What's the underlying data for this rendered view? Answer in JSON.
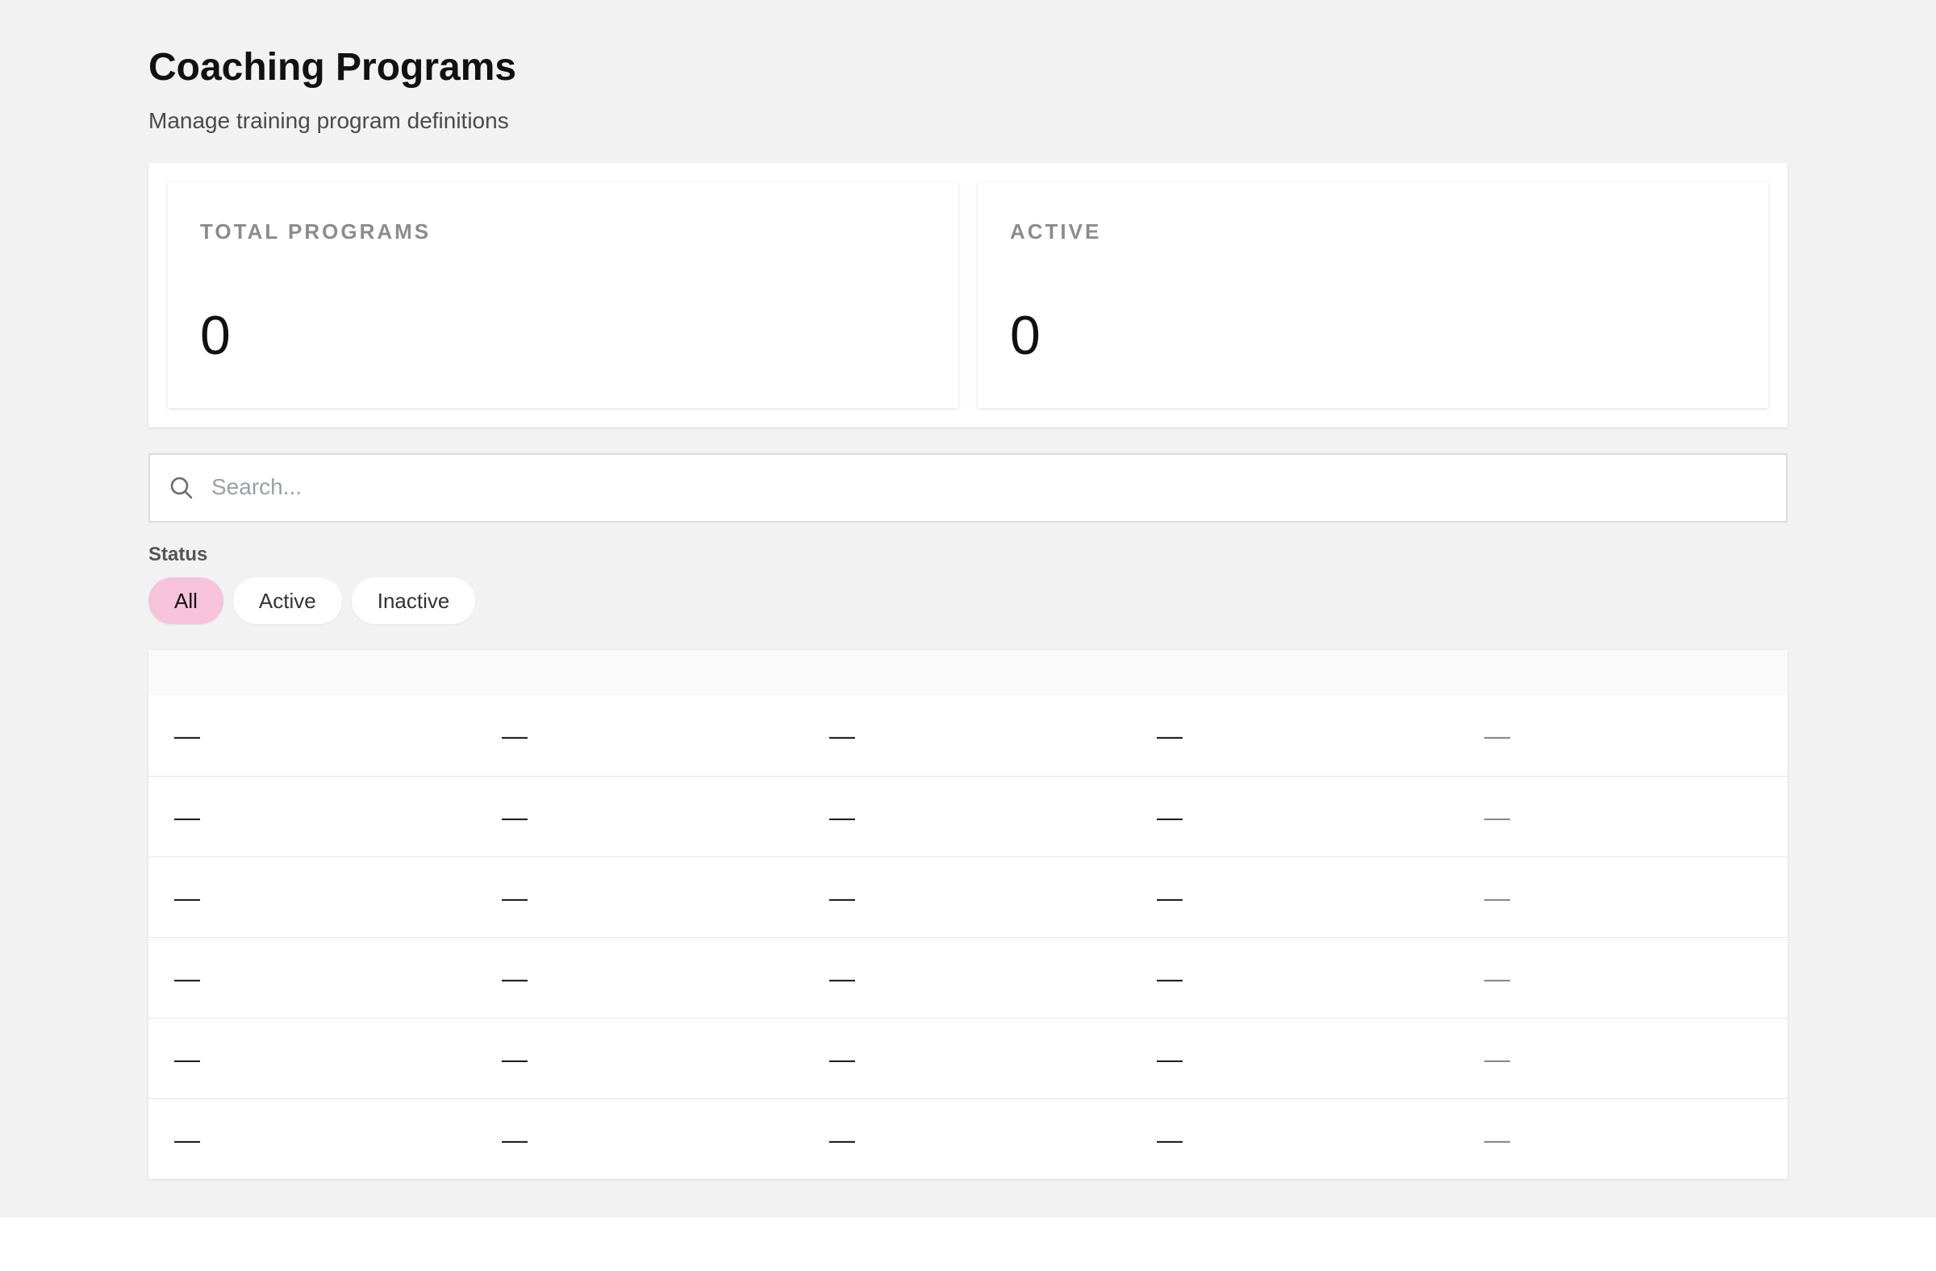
{
  "header": {
    "title": "Coaching Programs",
    "subtitle": "Manage training program definitions"
  },
  "stats": [
    {
      "label": "TOTAL PROGRAMS",
      "value": "0"
    },
    {
      "label": "ACTIVE",
      "value": "0"
    }
  ],
  "search": {
    "placeholder": "Search...",
    "value": "",
    "icon": "search-icon"
  },
  "filters": {
    "label": "Status",
    "options": [
      "All",
      "Active",
      "Inactive"
    ],
    "selected": "All"
  },
  "colors": {
    "selected_chip": "#f7c3da",
    "background": "#f2f2f2"
  },
  "table": {
    "rows": [
      [
        "—",
        "—",
        "—",
        "—",
        "—"
      ],
      [
        "—",
        "—",
        "—",
        "—",
        "—"
      ],
      [
        "—",
        "—",
        "—",
        "—",
        "—"
      ],
      [
        "—",
        "—",
        "—",
        "—",
        "—"
      ],
      [
        "—",
        "—",
        "—",
        "—",
        "—"
      ],
      [
        "—",
        "—",
        "—",
        "—",
        "—"
      ]
    ]
  }
}
